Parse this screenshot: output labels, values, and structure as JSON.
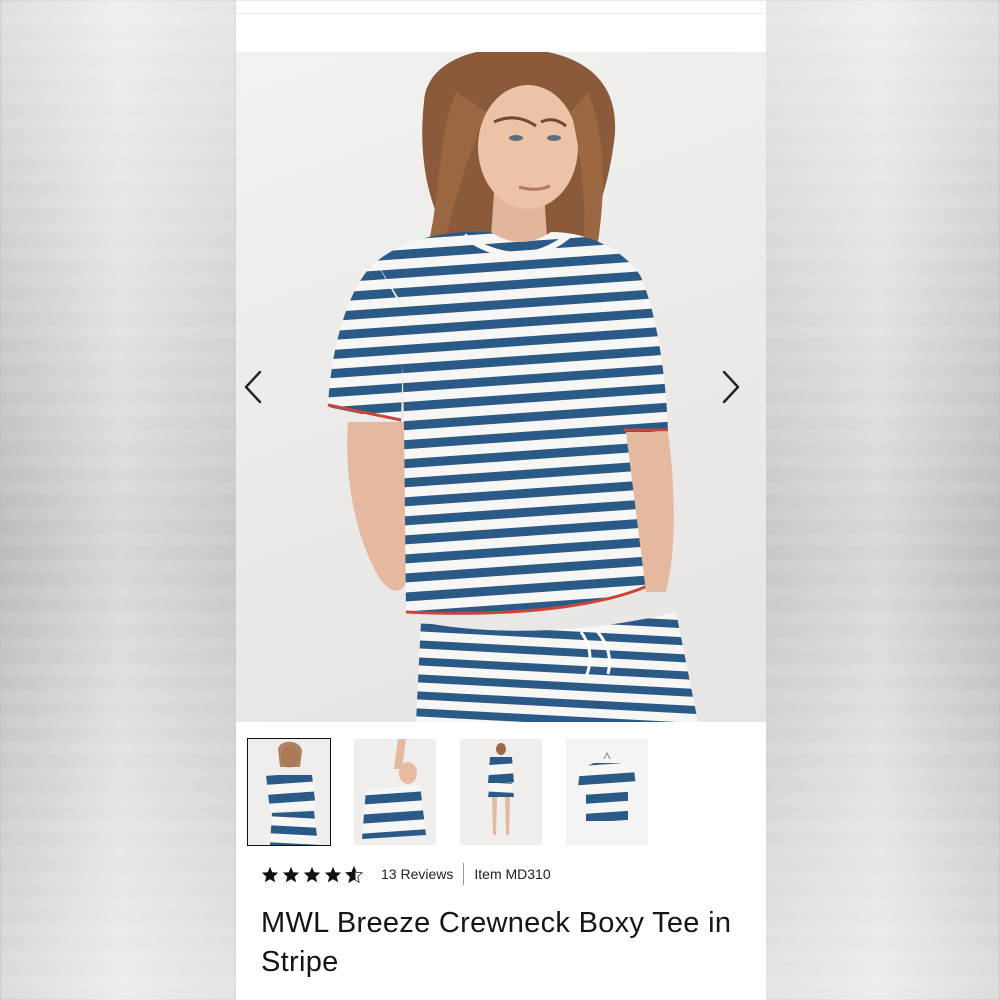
{
  "product": {
    "title": "MWL Breeze Crewneck Boxy Tee in Stripe",
    "rating": 4.5,
    "rating_max": 5,
    "reviews_label": "13 Reviews",
    "item_label": "Item MD310"
  },
  "gallery": {
    "prev_icon": "chevron-left-icon",
    "next_icon": "chevron-right-icon",
    "thumbnails": [
      "front-view",
      "arms-up-view",
      "back-view",
      "flat-lay-view"
    ],
    "active_index": 0
  },
  "colors": {
    "stripe_blue": "#2b5a87",
    "stripe_white": "#f6f6f4",
    "accent_red": "#c8463a",
    "text": "#151515"
  }
}
